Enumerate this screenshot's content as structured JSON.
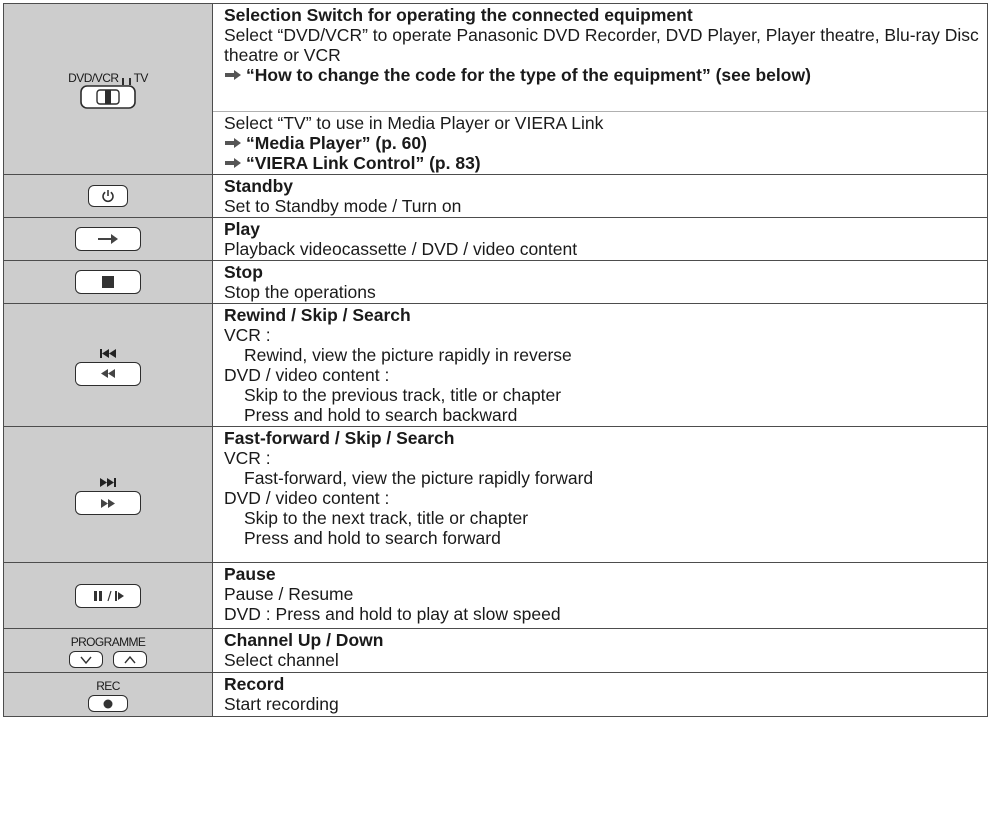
{
  "rows": [
    {
      "key": "selection",
      "icon": "dvd-vcr-tv-selection-switch-icon",
      "switch_left": "DVD/VCR",
      "switch_right": "TV",
      "title": "Selection Switch for operating the connected equipment",
      "lines": [
        "Select “DVD/VCR” to operate Panasonic DVD Recorder, DVD Player, Player theatre, Blu-ray Disc theatre or VCR",
        "“How to change the code for the type of the equipment” (see below)"
      ],
      "sub_lines": [
        "Select “TV” to use in Media Player or VIERA Link",
        "“Media Player” (p. 60)",
        "“VIERA Link Control” (p. 83)"
      ]
    },
    {
      "key": "standby",
      "icon": "power-icon",
      "title": "Standby",
      "lines": [
        "Set to Standby mode / Turn on"
      ]
    },
    {
      "key": "play",
      "icon": "play-icon",
      "title": "Play",
      "lines": [
        "Playback videocassette / DVD / video content"
      ]
    },
    {
      "key": "stop",
      "icon": "stop-icon",
      "title": "Stop",
      "lines": [
        "Stop the operations"
      ]
    },
    {
      "key": "rewind",
      "icon": "rewind-icon",
      "top_glyph": "skip-previous-icon",
      "title": "Rewind / Skip / Search",
      "lines": [
        "VCR :",
        "Rewind, view the picture rapidly in reverse",
        "DVD / video content :",
        "Skip to the previous track, title or chapter",
        "Press and hold to search backward"
      ]
    },
    {
      "key": "fastforward",
      "icon": "fast-forward-icon",
      "top_glyph": "skip-next-icon",
      "title": "Fast-forward / Skip / Search",
      "lines": [
        "VCR :",
        "Fast-forward, view the picture rapidly forward",
        "DVD / video content :",
        "Skip to the next track, title or chapter",
        "Press and hold to search forward"
      ]
    },
    {
      "key": "pause",
      "icon": "pause-slow-icon",
      "title": "Pause",
      "lines": [
        "Pause / Resume",
        "DVD : Press and hold to play at slow speed"
      ]
    },
    {
      "key": "programme",
      "caption": "PROGRAMME",
      "icon": "channel-up-down-icon",
      "title": "Channel Up / Down",
      "lines": [
        "Select channel"
      ]
    },
    {
      "key": "record",
      "caption": "REC",
      "icon": "record-icon",
      "title": "Record",
      "lines": [
        "Start recording"
      ]
    }
  ]
}
